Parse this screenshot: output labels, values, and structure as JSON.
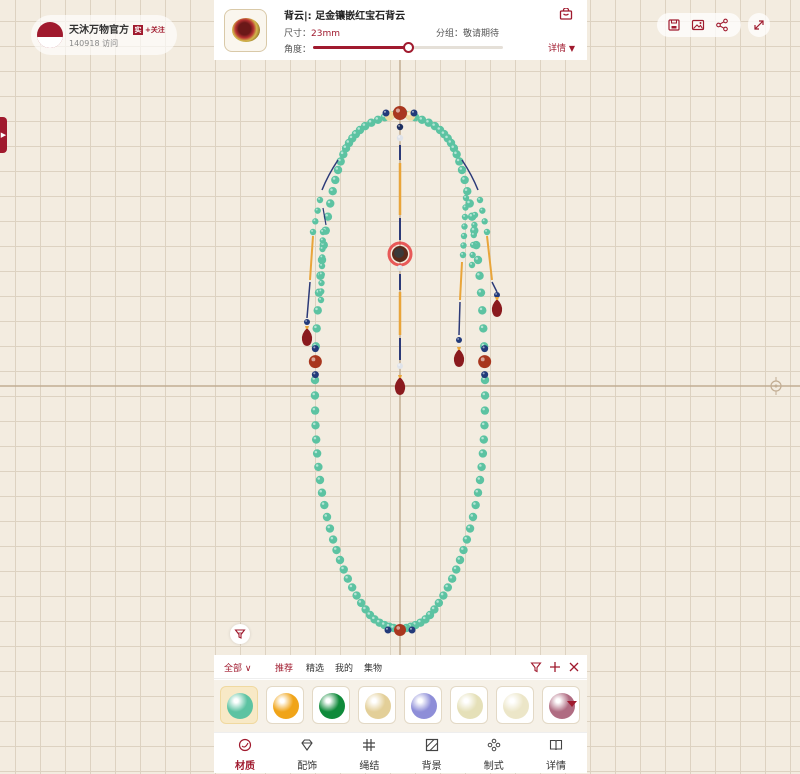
{
  "profile": {
    "name": "天沐万物官方",
    "badge": "实",
    "follow": "+关注",
    "visits": "140918 访问"
  },
  "product": {
    "title": "背云|: 足金镶嵌红宝石背云",
    "size_label": "尺寸：",
    "size_value": "23mm",
    "group_label": "分组：",
    "group_value": "敬请期待",
    "angle_label": "角度：",
    "angle_value": 0.5,
    "detail_label": "详情"
  },
  "categories": {
    "all": "全部",
    "tabs": [
      "推荐",
      "精选",
      "我的",
      "集物"
    ]
  },
  "swatches": [
    {
      "name": "jade-green",
      "color": "#5cc3a2",
      "selected": true
    },
    {
      "name": "amber",
      "color": "#f0a418",
      "selected": false
    },
    {
      "name": "emerald",
      "color": "#0f8a3a",
      "selected": false
    },
    {
      "name": "ivory",
      "color": "#e3cf98",
      "selected": false
    },
    {
      "name": "lavender",
      "color": "#8e8ed8",
      "selected": false
    },
    {
      "name": "pale-jade",
      "color": "#e5e0b8",
      "selected": false
    },
    {
      "name": "milky-white",
      "color": "#ece6c8",
      "selected": false
    },
    {
      "name": "tourmaline",
      "color": "#b06c82",
      "selected": false
    }
  ],
  "nav": [
    {
      "label": "材质",
      "icon": "material-icon",
      "active": true
    },
    {
      "label": "配饰",
      "icon": "diamond-icon",
      "active": false
    },
    {
      "label": "绳结",
      "icon": "knot-icon",
      "active": false
    },
    {
      "label": "背景",
      "icon": "background-icon",
      "active": false
    },
    {
      "label": "制式",
      "icon": "pattern-icon",
      "active": false
    },
    {
      "label": "详情",
      "icon": "book-icon",
      "active": false
    }
  ],
  "colors": {
    "accent": "#a01a2e",
    "bead": "#5cc3a2",
    "gold": "#e9a53a",
    "lapis": "#223a7a",
    "carnelian": "#a8361e"
  }
}
